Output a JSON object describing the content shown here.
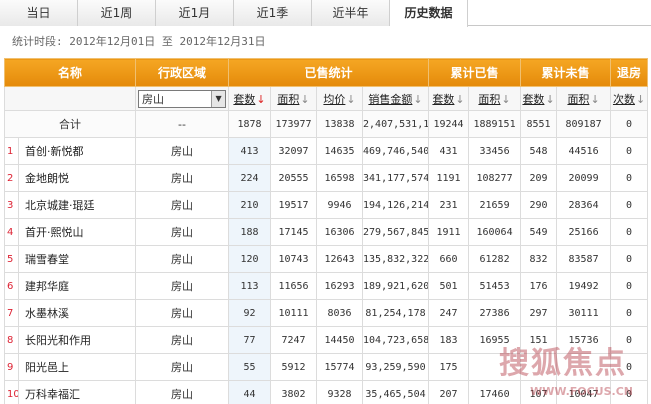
{
  "tabs": [
    "当日",
    "近1周",
    "近1月",
    "近1季",
    "近半年",
    "历史数据"
  ],
  "active_tab": 5,
  "period": "统计时段: 2012年12月01日 至 2012年12月31日",
  "header": {
    "name": "名称",
    "region": "行政区域",
    "sold": "已售统计",
    "cum_sold": "累计已售",
    "cum_unsold": "累计未售",
    "returned": "退房"
  },
  "subheader": {
    "region_select": "房山",
    "count": "套数",
    "area": "面积",
    "avg_price": "均价",
    "amount": "销售金额",
    "cum_count": "套数",
    "cum_area": "面积",
    "unsold_count": "套数",
    "unsold_area": "面积",
    "returns": "次数"
  },
  "total": {
    "label": "合计",
    "region": "--",
    "count": "1878",
    "area": "173977",
    "avg_price": "13838",
    "amount": "2,407,531,186",
    "cum_count": "19244",
    "cum_area": "1889151",
    "unsold_count": "8551",
    "unsold_area": "809187",
    "returns": "0"
  },
  "rows": [
    {
      "rank": "1",
      "name": "首创·新悦都",
      "region": "房山",
      "count": "413",
      "area": "32097",
      "avg_price": "14635",
      "amount": "469,746,540",
      "cum_count": "431",
      "cum_area": "33456",
      "unsold_count": "548",
      "unsold_area": "44516",
      "returns": "0"
    },
    {
      "rank": "2",
      "name": "金地朗悦",
      "region": "房山",
      "count": "224",
      "area": "20555",
      "avg_price": "16598",
      "amount": "341,177,574",
      "cum_count": "1191",
      "cum_area": "108277",
      "unsold_count": "209",
      "unsold_area": "20099",
      "returns": "0"
    },
    {
      "rank": "3",
      "name": "北京城建·琨廷",
      "region": "房山",
      "count": "210",
      "area": "19517",
      "avg_price": "9946",
      "amount": "194,126,214",
      "cum_count": "231",
      "cum_area": "21659",
      "unsold_count": "290",
      "unsold_area": "28364",
      "returns": "0"
    },
    {
      "rank": "4",
      "name": "首开·熙悦山",
      "region": "房山",
      "count": "188",
      "area": "17145",
      "avg_price": "16306",
      "amount": "279,567,845",
      "cum_count": "1911",
      "cum_area": "160064",
      "unsold_count": "549",
      "unsold_area": "25166",
      "returns": "0"
    },
    {
      "rank": "5",
      "name": "瑞雪春堂",
      "region": "房山",
      "count": "120",
      "area": "10743",
      "avg_price": "12643",
      "amount": "135,832,322",
      "cum_count": "660",
      "cum_area": "61282",
      "unsold_count": "832",
      "unsold_area": "83587",
      "returns": "0"
    },
    {
      "rank": "6",
      "name": "建邦华庭",
      "region": "房山",
      "count": "113",
      "area": "11656",
      "avg_price": "16293",
      "amount": "189,921,620",
      "cum_count": "501",
      "cum_area": "51453",
      "unsold_count": "176",
      "unsold_area": "19492",
      "returns": "0"
    },
    {
      "rank": "7",
      "name": "水墨林溪",
      "region": "房山",
      "count": "92",
      "area": "10111",
      "avg_price": "8036",
      "amount": "81,254,178",
      "cum_count": "247",
      "cum_area": "27386",
      "unsold_count": "297",
      "unsold_area": "30111",
      "returns": "0"
    },
    {
      "rank": "8",
      "name": "长阳光和作用",
      "region": "房山",
      "count": "77",
      "area": "7247",
      "avg_price": "14450",
      "amount": "104,723,658",
      "cum_count": "183",
      "cum_area": "16955",
      "unsold_count": "151",
      "unsold_area": "15736",
      "returns": "0"
    },
    {
      "rank": "9",
      "name": "阳光邑上",
      "region": "房山",
      "count": "55",
      "area": "5912",
      "avg_price": "15774",
      "amount": "93,259,590",
      "cum_count": "175",
      "cum_area": "",
      "unsold_count": "",
      "unsold_area": "",
      "returns": "0"
    },
    {
      "rank": "10",
      "name": "万科幸福汇",
      "region": "房山",
      "count": "44",
      "area": "3802",
      "avg_price": "9328",
      "amount": "35,465,504",
      "cum_count": "207",
      "cum_area": "17460",
      "unsold_count": "107",
      "unsold_area": "10047",
      "returns": "0"
    }
  ],
  "watermark": {
    "text": "搜狐焦点",
    "url": "WWW.FOCUS.CN"
  },
  "colors": {
    "header": "#f0a020",
    "rank": "#d22233"
  }
}
